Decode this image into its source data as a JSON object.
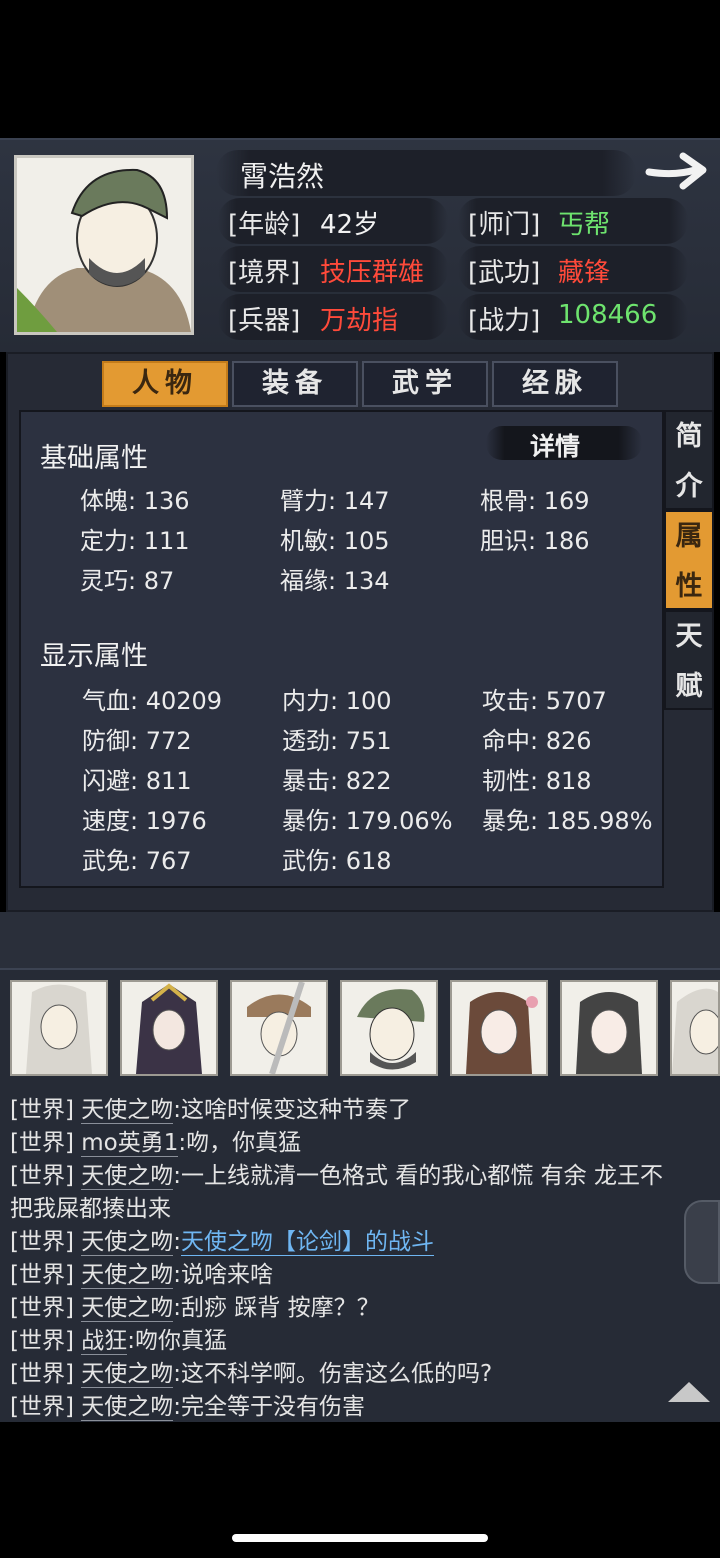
{
  "character": {
    "name": "霄浩然",
    "fields": {
      "age_label": "[年龄]",
      "age_value": "42岁",
      "sect_label": "[师门]",
      "sect_value": "丐帮",
      "realm_label": "[境界]",
      "realm_value": "技压群雄",
      "skill_label": "[武功]",
      "skill_value": "藏锋",
      "weapon_label": "[兵器]",
      "weapon_value": "万劫指",
      "power_label": "[战力]",
      "power_value": "108466"
    }
  },
  "tabs": [
    "人物",
    "装备",
    "武学",
    "经脉"
  ],
  "active_tab": "人物",
  "side_tabs": [
    {
      "label_1": "简",
      "label_2": "介"
    },
    {
      "label_1": "属",
      "label_2": "性"
    },
    {
      "label_1": "天",
      "label_2": "赋"
    }
  ],
  "details_label": "详情",
  "basic_attrs": {
    "title": "基础属性",
    "items": [
      "体魄: 136",
      "臂力: 147",
      "根骨: 169",
      "定力: 111",
      "机敏: 105",
      "胆识: 186",
      "灵巧: 87",
      "福缘: 134"
    ]
  },
  "display_attrs": {
    "title": "显示属性",
    "items": [
      "气血: 40209",
      "内力: 100",
      "攻击: 5707",
      "防御: 772",
      "透劲: 751",
      "命中: 826",
      "闪避: 811",
      "暴击: 822",
      "韧性: 818",
      "速度: 1976",
      "暴伤: 179.06%",
      "暴免: 185.98%",
      "武免: 767",
      "武伤: 618"
    ]
  },
  "chat": [
    {
      "channel": "[世界]",
      "name": "天使之吻",
      "text": ":这啥时候变这种节奏了"
    },
    {
      "channel": "[世界]",
      "name": "mo英勇1",
      "text": ":吻，你真猛"
    },
    {
      "channel": "[世界]",
      "name": "天使之吻",
      "text": ":一上线就清一色格式 看的我心都慌 有余 龙王不"
    },
    {
      "continuation": "把我屎都揍出来"
    },
    {
      "channel": "[世界]",
      "name": "天使之吻",
      "text": ":",
      "link": "天使之吻【论剑】的战斗"
    },
    {
      "channel": "[世界]",
      "name": "天使之吻",
      "text": ":说啥来啥"
    },
    {
      "channel": "[世界]",
      "name": "天使之吻",
      "text": ":刮痧 踩背 按摩？？"
    },
    {
      "channel": "[世界]",
      "name": "战狂",
      "text": ":吻你真猛"
    },
    {
      "channel": "[世界]",
      "name": "天使之吻",
      "text": ":这不科学啊。伤害这么低的吗?"
    },
    {
      "channel": "[世界]",
      "name": "天使之吻",
      "text": ":完全等于没有伤害"
    }
  ],
  "icons": [
    "arrow-right-icon",
    "collapse-up-icon"
  ],
  "colors": {
    "accent": "#e39a32",
    "green": "#6ee36e",
    "red": "#ff4a3a",
    "link": "#6fb6f2"
  }
}
